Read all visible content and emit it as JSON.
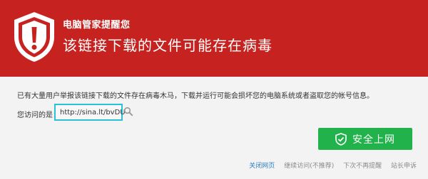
{
  "header": {
    "brand": "电脑管家提醒您",
    "title": "该链接下载的文件可能存在病毒",
    "bg_color": "#c62320",
    "icon": "shield-alert-icon"
  },
  "warning": {
    "description": "已有大量用户举报该链接下载的文件存在病毒木马，下载并运行可能会损坏您的电脑系统或者盗取您的帐号信息。",
    "url_label": "您访问的是：",
    "url": "http://sina.lt/bvDU"
  },
  "actions": {
    "safe_button": "安全上网",
    "safe_button_color": "#22b24c",
    "close_page": "关闭网页",
    "continue": "继续访问(不推荐)",
    "no_prompt": "下次不再提醒",
    "report": "站长申诉"
  }
}
